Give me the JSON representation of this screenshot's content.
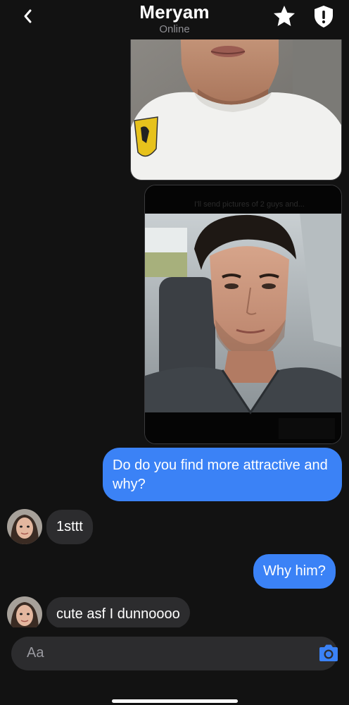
{
  "header": {
    "title": "Meryam",
    "status": "Online",
    "back_icon": "chevron-left-icon",
    "favorite_icon": "star-icon",
    "report_icon": "shield-alert-icon"
  },
  "messages": [
    {
      "type": "image",
      "side": "sent",
      "description_icon": "photo-icon"
    },
    {
      "type": "image",
      "side": "sent",
      "caption_overlay": "I'll send pictures of 2 guys and..."
    },
    {
      "type": "text",
      "side": "sent",
      "text": "Do do you find more attractive and why?"
    },
    {
      "type": "text",
      "side": "received",
      "text": "1sttt"
    },
    {
      "type": "text",
      "side": "sent",
      "text": "Why him?"
    },
    {
      "type": "text",
      "side": "received",
      "text": "cute asf I dunnoooo"
    }
  ],
  "composer": {
    "placeholder": "Aa",
    "camera_icon": "camera-icon"
  },
  "colors": {
    "background": "#121212",
    "sent_bubble": "#3b82f6",
    "received_bubble": "#2c2c2e",
    "accent": "#3b82f6"
  }
}
